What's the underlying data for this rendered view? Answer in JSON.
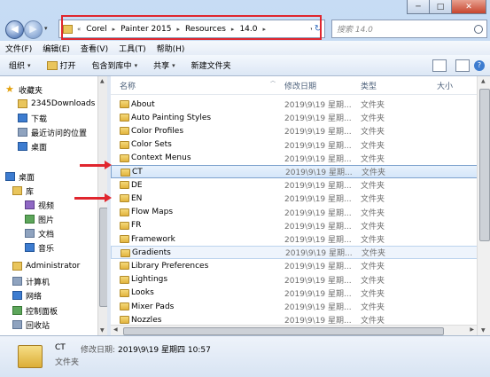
{
  "window": {
    "buttons": {
      "minimize": "─",
      "maximize": "□",
      "close": "✕"
    }
  },
  "nav": {
    "back": "◀",
    "forward": "▶",
    "dropdown": "▾"
  },
  "address": {
    "prefix": "«",
    "crumbs": [
      "Corel",
      "Painter 2015",
      "Resources",
      "14.0"
    ],
    "separator": "▸",
    "dropdown": "▾"
  },
  "refresh": "↻",
  "search": {
    "placeholder": "搜索 14.0"
  },
  "menu": {
    "items": [
      "文件(F)",
      "编辑(E)",
      "查看(V)",
      "工具(T)",
      "帮助(H)"
    ]
  },
  "toolbar": {
    "organize": "组织",
    "open": "打开",
    "include_in_library": "包含到库中",
    "share": "共享",
    "new_folder": "新建文件夹",
    "arrow": "▾",
    "help": "?"
  },
  "navpane": {
    "favorites": "收藏夹",
    "items": [
      {
        "label": "2345Downloads",
        "icon": "folder-icon"
      },
      {
        "label": "下载",
        "icon": "download-icon"
      },
      {
        "label": "最近访问的位置",
        "icon": "recent-places-icon"
      },
      {
        "label": "桌面",
        "icon": "desktop-icon"
      }
    ],
    "desktop": "桌面",
    "library": "库",
    "library_items": [
      {
        "label": "视频",
        "icon": "video-icon"
      },
      {
        "label": "图片",
        "icon": "picture-icon"
      },
      {
        "label": "文档",
        "icon": "document-icon"
      },
      {
        "label": "音乐",
        "icon": "music-icon"
      }
    ],
    "user": "Administrator",
    "computer": "计算机",
    "network": "网络",
    "control_panel": "控制面板",
    "recycle_bin": "回收站"
  },
  "list": {
    "columns": {
      "name": "名称",
      "date": "修改日期",
      "type": "类型",
      "size": "大小",
      "sort_arrow": "︿"
    },
    "rows": [
      {
        "name": "About",
        "date": "2019\\9\\19 星期...",
        "type": "文件夹"
      },
      {
        "name": "Auto Painting Styles",
        "date": "2019\\9\\19 星期...",
        "type": "文件夹"
      },
      {
        "name": "Color Profiles",
        "date": "2019\\9\\19 星期...",
        "type": "文件夹"
      },
      {
        "name": "Color Sets",
        "date": "2019\\9\\19 星期...",
        "type": "文件夹"
      },
      {
        "name": "Context Menus",
        "date": "2019\\9\\19 星期...",
        "type": "文件夹"
      },
      {
        "name": "CT",
        "date": "2019\\9\\19 星期...",
        "type": "文件夹"
      },
      {
        "name": "DE",
        "date": "2019\\9\\19 星期...",
        "type": "文件夹"
      },
      {
        "name": "EN",
        "date": "2019\\9\\19 星期...",
        "type": "文件夹"
      },
      {
        "name": "Flow Maps",
        "date": "2019\\9\\19 星期...",
        "type": "文件夹"
      },
      {
        "name": "FR",
        "date": "2019\\9\\19 星期...",
        "type": "文件夹"
      },
      {
        "name": "Framework",
        "date": "2019\\9\\19 星期...",
        "type": "文件夹"
      },
      {
        "name": "Gradients",
        "date": "2019\\9\\19 星期...",
        "type": "文件夹"
      },
      {
        "name": "Library Preferences",
        "date": "2019\\9\\19 星期...",
        "type": "文件夹"
      },
      {
        "name": "Lightings",
        "date": "2019\\9\\19 星期...",
        "type": "文件夹"
      },
      {
        "name": "Looks",
        "date": "2019\\9\\19 星期...",
        "type": "文件夹"
      },
      {
        "name": "Mixer Pads",
        "date": "2019\\9\\19 星期...",
        "type": "文件夹"
      },
      {
        "name": "Nozzles",
        "date": "2019\\9\\19 星期...",
        "type": "文件夹"
      }
    ],
    "selected_index": 5,
    "hover_index": 11
  },
  "details": {
    "name": "CT",
    "modified_label": "修改日期:",
    "modified_value": "2019\\9\\19 星期四 10:57",
    "type": "文件夹"
  },
  "colors": {
    "accent": "#3d7cd0",
    "highlight": "#e0262e",
    "folder": "#e9c55c"
  }
}
